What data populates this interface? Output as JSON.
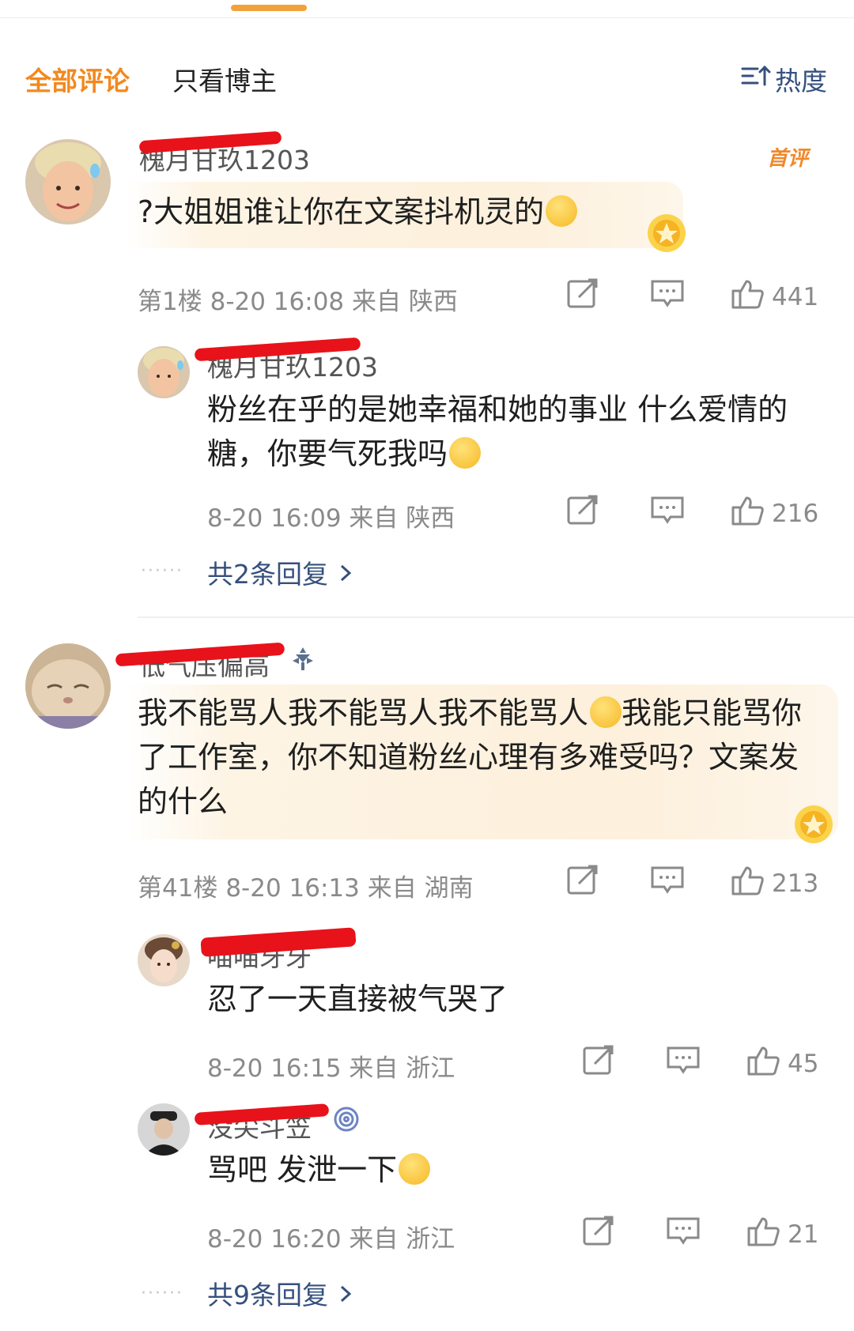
{
  "tabs": {
    "all": "全部评论",
    "owner_only": "只看博主",
    "sort": "热度"
  },
  "threads": [
    {
      "username": "槐月甘玖1203",
      "badge": "首评",
      "text": "?大姐姐谁让你在文案抖机灵的",
      "emoji": "hug-emoji",
      "floor": "第1楼",
      "time": "8-20 16:08",
      "location": "来自 陕西",
      "likes": "441",
      "replies": [
        {
          "username": "槐月甘玖1203",
          "text": "粉丝在乎的是她幸福和她的事业 什么爱情的糖，你要气死我吗",
          "emoji": "crying-laugh-emoji",
          "time": "8-20 16:09",
          "location": "来自 陕西",
          "likes": "216"
        }
      ],
      "reply_count_label": "共2条回复"
    },
    {
      "username": "低气压偏高",
      "text": "我不能骂人我不能骂人我不能骂人",
      "text_after_emoji": "我能只能骂你了工作室，你不知道粉丝心理有多难受吗？文案发的什么",
      "emoji": "upside-down-face-emoji",
      "floor": "第41楼",
      "time": "8-20 16:13",
      "location": "来自 湖南",
      "likes": "213",
      "replies": [
        {
          "username": "喵喵牙牙",
          "text": "忍了一天直接被气哭了",
          "time": "8-20 16:15",
          "location": "来自 浙江",
          "likes": "45"
        },
        {
          "username": "没尖斗笠",
          "text": "骂吧 发泄一下",
          "emoji": "laughing-tears-emoji",
          "time": "8-20 16:20",
          "location": "来自 浙江",
          "likes": "21"
        }
      ],
      "reply_count_label": "共9条回复"
    }
  ],
  "colors": {
    "accent": "#f2891f",
    "link": "#35507d",
    "redaction": "#e8121a",
    "meta": "#8a8a8a"
  },
  "icons": [
    "sort-icon",
    "share-icon",
    "comment-icon",
    "like-icon",
    "chevron-right-icon",
    "medal-icon",
    "vip-icon"
  ]
}
